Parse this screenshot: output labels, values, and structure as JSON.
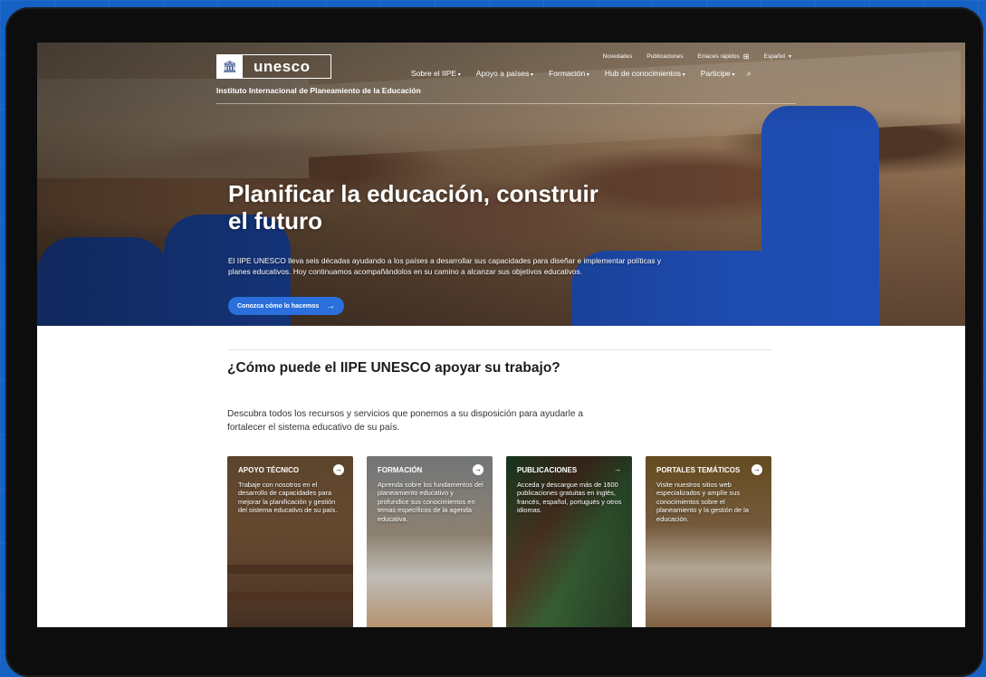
{
  "colors": {
    "background": "#1561c4",
    "accent": "#2a6fdb",
    "text": "#1d1d1d"
  },
  "header": {
    "logo_text": "unesco",
    "logo_icon": "temple-icon",
    "institute": "Instituto Internacional de Planeamiento de la Educación",
    "utility": {
      "news": "Novedades",
      "publications": "Publicaciones",
      "quick_links": "Enlaces rápidos",
      "language": "Español"
    },
    "nav": [
      {
        "label": "Sobre el IIPE"
      },
      {
        "label": "Apoyo a países"
      },
      {
        "label": "Formación"
      },
      {
        "label": "Hub de conocimientos"
      },
      {
        "label": "Participe"
      }
    ]
  },
  "hero": {
    "title": "Planificar la educación, construir el futuro",
    "description": "El IIPE UNESCO lleva seis décadas ayudando a los países a desarrollar sus capacidades para diseñar e implementar políticas y planes educativos. Hoy continuamos acompañándolos en su camino a alcanzar sus objetivos educativos.",
    "button_label": "Conozca cómo lo hacemos"
  },
  "section": {
    "title": "¿Cómo puede el IIPE UNESCO apoyar su trabajo?",
    "lead": "Descubra todos los recursos y servicios que ponemos a su disposición para ayudarle a fortalecer el sistema educativo de su país."
  },
  "cards": [
    {
      "title": "APOYO TÉCNICO",
      "text": "Trabaje con nosotros en el desarrollo de capacidades para mejorar la planificación y gestión del sistema educativo de su país."
    },
    {
      "title": "FORMACIÓN",
      "text": "Aprenda sobre los fundamentos del planeamiento educativo y profundice sus conocimientos en temas específicos de la agenda educativa."
    },
    {
      "title": "PUBLICACIONES",
      "text": "Acceda y descargue más de 1600 publicaciones gratuitas en inglés, francés, español, portugués y otros idiomas."
    },
    {
      "title": "PORTALES TEMÁTICOS",
      "text": "Visite nuestros sitios web especializados y amplíe sus conocimientos sobre el planeamiento y la gestión de la educación."
    }
  ]
}
